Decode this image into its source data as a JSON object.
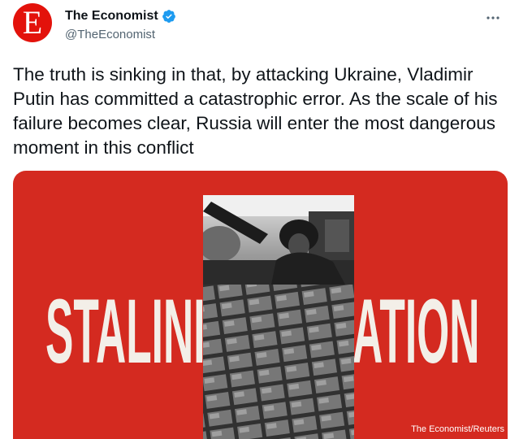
{
  "author": {
    "avatar_letter": "E",
    "display_name": "The Economist",
    "handle": "@TheEconomist",
    "verified": true,
    "verified_color": "#1d9bf0",
    "avatar_color": "#e3120b"
  },
  "more_menu_icon": "more-horizontal-icon",
  "tweet": {
    "text": "The truth is sinking in that, by attacking Ukraine, Vladimir Putin has committed a catastrophic error. As the scale of his failure becomes clear, Russia will enter the most dangerous moment in this conflict"
  },
  "media": {
    "background_color": "#d42a20",
    "headline_left": "STALINI",
    "headline_right": "ATION",
    "credit": "The Economist/Reuters"
  }
}
